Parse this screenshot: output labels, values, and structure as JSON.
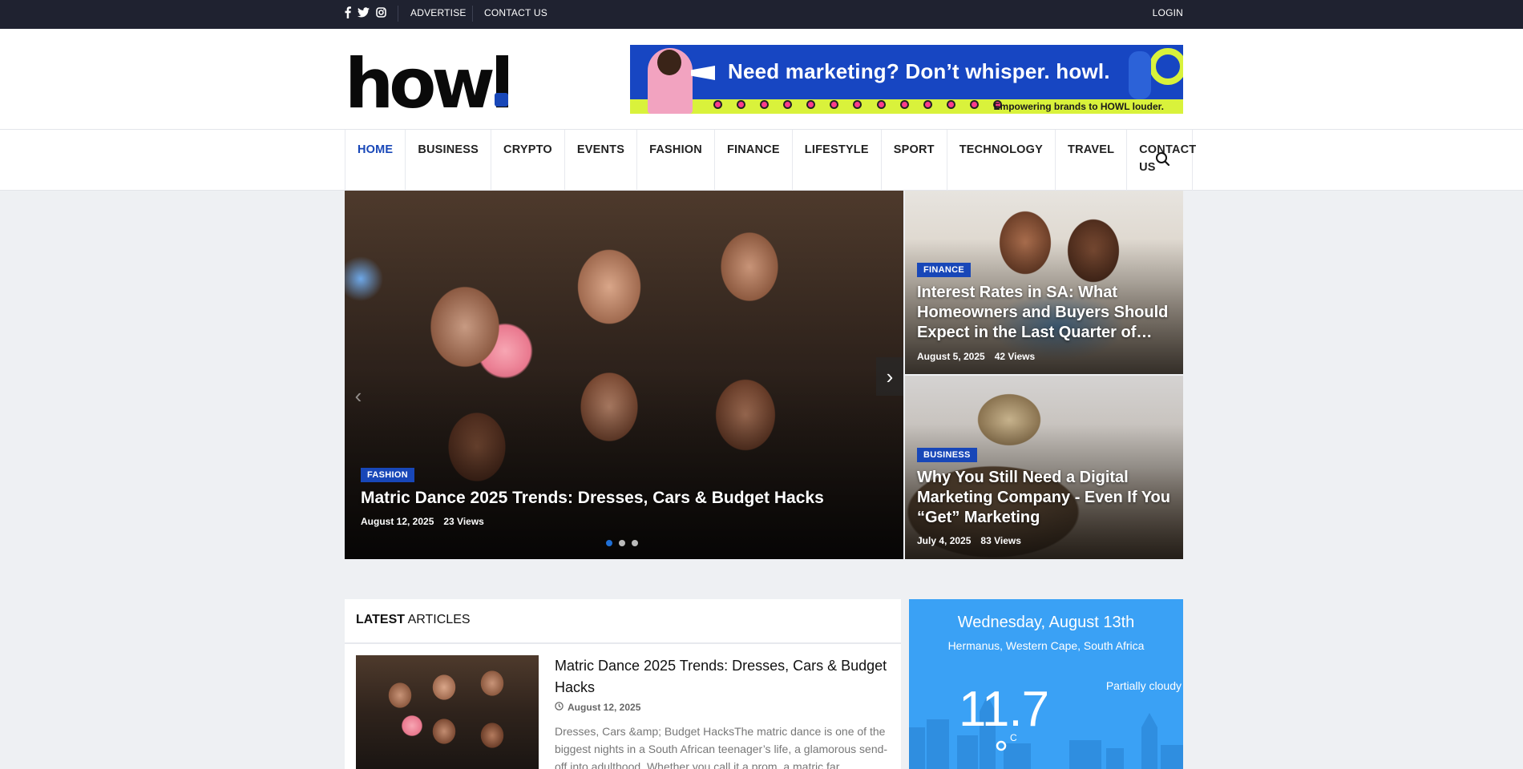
{
  "topbar": {
    "social_icons": [
      "facebook-icon",
      "twitter-icon",
      "instagram-icon"
    ],
    "links": [
      "ADVERTISE",
      "CONTACT US"
    ],
    "login": "LOGIN"
  },
  "header": {
    "logo": "howl",
    "banner": {
      "headline": "Need marketing? Don’t whisper. howl.",
      "subline": "Empowering brands to HOWL louder."
    }
  },
  "nav": {
    "items": [
      "HOME",
      "BUSINESS",
      "CRYPTO",
      "EVENTS",
      "FASHION",
      "FINANCE",
      "LIFESTYLE",
      "SPORT",
      "TECHNOLOGY",
      "TRAVEL",
      "CONTACT US"
    ],
    "active": "HOME",
    "search_icon": "search-icon"
  },
  "hero": {
    "main": {
      "category": "FASHION",
      "title": "Matric Dance 2025 Trends: Dresses, Cars & Budget Hacks",
      "date": "August 12, 2025",
      "views": "23 Views",
      "slides": 3,
      "active_slide": 1
    },
    "side": [
      {
        "category": "FINANCE",
        "title": "Interest Rates in SA: What Homeowners and Buyers Should Expect in the Last Quarter of…",
        "date": "August 5, 2025",
        "views": "42 Views"
      },
      {
        "category": "BUSINESS",
        "title": "Why You Still Need a Digital Marketing Company - Even If You “Get” Marketing",
        "date": "July 4, 2025",
        "views": "83 Views"
      }
    ]
  },
  "latest": {
    "heading_bold": "LATEST",
    "heading_rest": " ARTICLES",
    "article": {
      "title": "Matric Dance 2025 Trends: Dresses, Cars & Budget Hacks",
      "date": "August 12, 2025",
      "excerpt": "Dresses, Cars &amp; Budget HacksThe matric dance is one of the biggest nights in a South African teenager’s life, a glamorous send-off into adulthood. Whether you call it a prom, a matric far..."
    }
  },
  "weather": {
    "day": "Wednesday, August 13th",
    "location": "Hermanus, Western Cape, South Africa",
    "condition": "Partially cloudy",
    "temperature": "11.7",
    "unit": "C"
  },
  "colors": {
    "accent": "#1847b8",
    "topbar": "#1f2230",
    "weather": "#3aa1f5"
  }
}
